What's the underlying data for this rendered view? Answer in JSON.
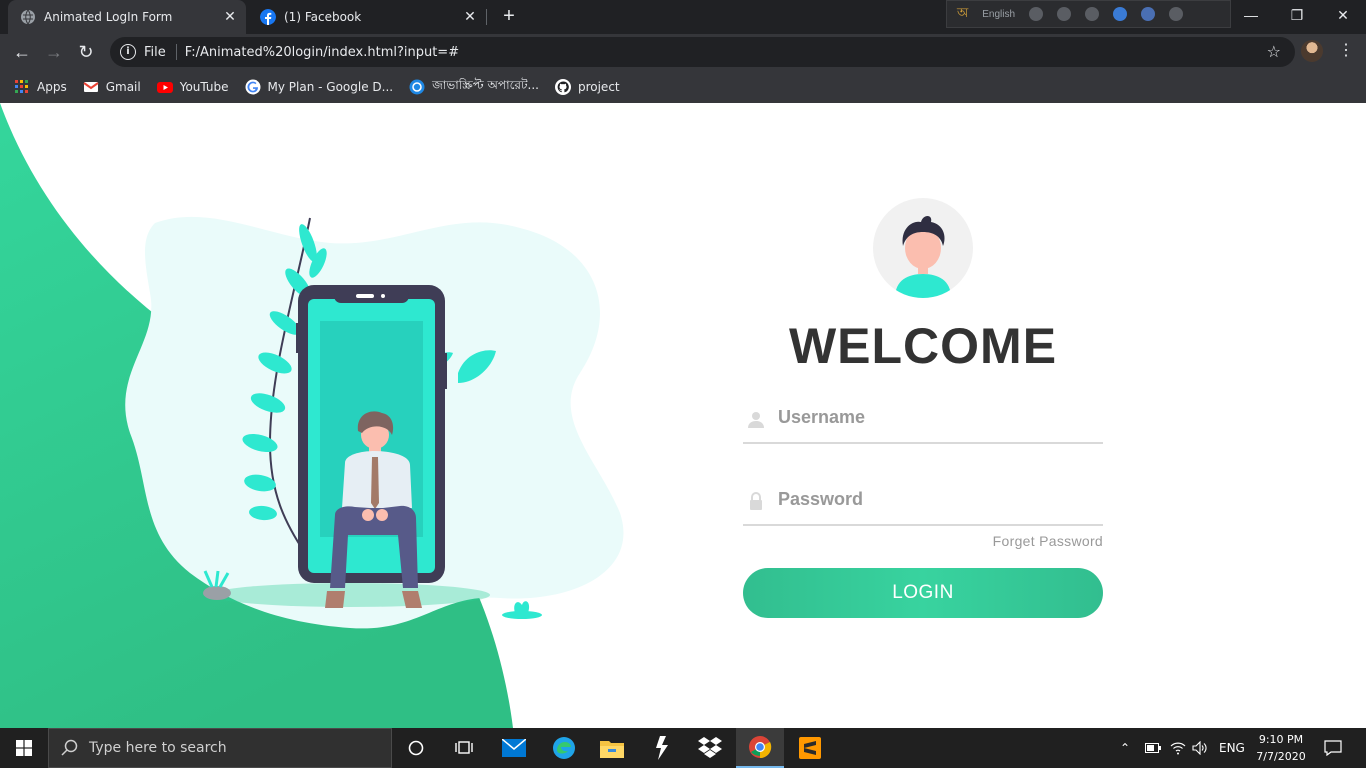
{
  "browser": {
    "tabs": [
      {
        "title": "Animated LogIn Form",
        "active": true,
        "favicon": "globe-icon"
      },
      {
        "title": "(1) Facebook",
        "active": false,
        "favicon": "facebook-icon"
      }
    ],
    "ime_language": "English",
    "address": {
      "scheme_label": "File",
      "url": "F:/Animated%20login/index.html?input=#"
    },
    "bookmarks": [
      {
        "label": "Apps",
        "icon": "apps-grid-icon"
      },
      {
        "label": "Gmail",
        "icon": "gmail-icon"
      },
      {
        "label": "YouTube",
        "icon": "youtube-icon"
      },
      {
        "label": "My Plan - Google D...",
        "icon": "google-icon"
      },
      {
        "label": "জাভাস্ক্রিপ্ট অপারেট...",
        "icon": "web-icon"
      },
      {
        "label": "project",
        "icon": "github-icon"
      }
    ]
  },
  "login": {
    "heading": "WELCOME",
    "username_placeholder": "Username",
    "password_placeholder": "Password",
    "forgot_label": "Forget Password",
    "login_label": "LOGIN"
  },
  "colors": {
    "accent": "#38d39f",
    "accent_dark": "#32be8f",
    "illustration_blob": "#eafbfa",
    "phone_frame": "#3f3d56",
    "phone_screen": "#2ee8d0"
  },
  "taskbar": {
    "search_placeholder": "Type here to search",
    "language": "ENG",
    "time": "9:10 PM",
    "date": "7/7/2020"
  }
}
